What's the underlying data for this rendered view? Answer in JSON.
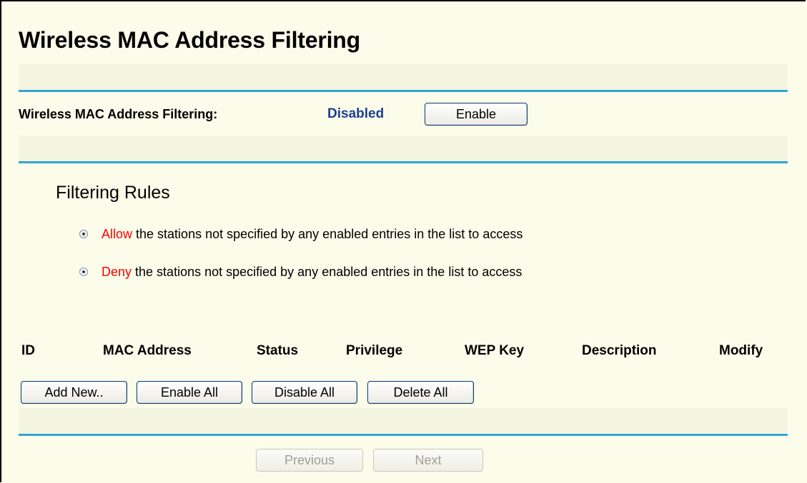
{
  "page": {
    "title": "Wireless MAC Address Filtering"
  },
  "filtering": {
    "label": "Wireless MAC Address Filtering:",
    "status": "Disabled",
    "enable_button": "Enable"
  },
  "rules": {
    "heading": "Filtering Rules",
    "options": [
      {
        "keyword": "Allow",
        "text": " the stations not specified by any enabled entries in the list to access"
      },
      {
        "keyword": "Deny",
        "text": " the stations not specified by any enabled entries in the list to access"
      }
    ]
  },
  "table": {
    "columns": [
      "ID",
      "MAC Address",
      "Status",
      "Privilege",
      "WEP Key",
      "Description",
      "Modify"
    ]
  },
  "actions": {
    "add_new": "Add New..",
    "enable_all": "Enable All",
    "disable_all": "Disable All",
    "delete_all": "Delete All"
  },
  "pager": {
    "previous": "Previous",
    "next": "Next"
  },
  "colors": {
    "accent_rule": "#2fa6d6",
    "status_blue": "#1e3f8f",
    "keyword_red": "#ff0000",
    "background": "#fbfcea"
  }
}
